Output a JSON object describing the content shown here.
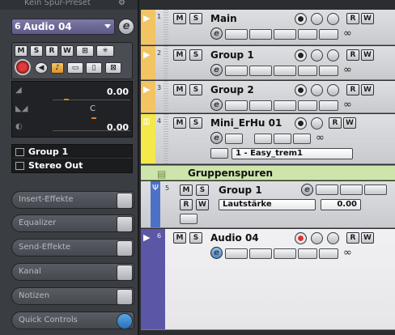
{
  "inspector": {
    "preset_label": "Kein Spur-Preset",
    "track_number": "6",
    "track_name": "Audio 04",
    "edit_label": "e",
    "buttons": [
      "M",
      "S",
      "R",
      "W"
    ],
    "volume_value": "0.00",
    "pan_value": "C",
    "delay_value": "0.00",
    "input_routing": "Group 1",
    "output_routing": "Stereo Out",
    "sections": [
      {
        "label": "Insert-Effekte"
      },
      {
        "label": "Equalizer"
      },
      {
        "label": "Send-Effekte"
      },
      {
        "label": "Kanal"
      },
      {
        "label": "Notizen"
      },
      {
        "label": "Quick Controls"
      }
    ]
  },
  "tracks": [
    {
      "number": "1",
      "name": "Main",
      "color": "#f2c464"
    },
    {
      "number": "2",
      "name": "Group 1",
      "color": "#f2c464"
    },
    {
      "number": "3",
      "name": "Group 2",
      "color": "#f2c464"
    },
    {
      "number": "4",
      "name": "Mini_ErHu 01",
      "color": "#f4e84a",
      "preset": "1 - Easy_trem1"
    },
    {
      "number": "5",
      "name": "Group 1",
      "color": "#4e71c8",
      "automation_param": "Lautstärke",
      "automation_value": "0.00"
    },
    {
      "number": "6",
      "name": "Audio 04",
      "color": "#5b57a6"
    }
  ],
  "folder": {
    "label": "Gruppenspuren",
    "color": "#cde5ac"
  },
  "colors": {
    "accent_purple": "#6e6a98",
    "record_red": "#e23a3a",
    "qc_blue": "#3b85cf"
  }
}
